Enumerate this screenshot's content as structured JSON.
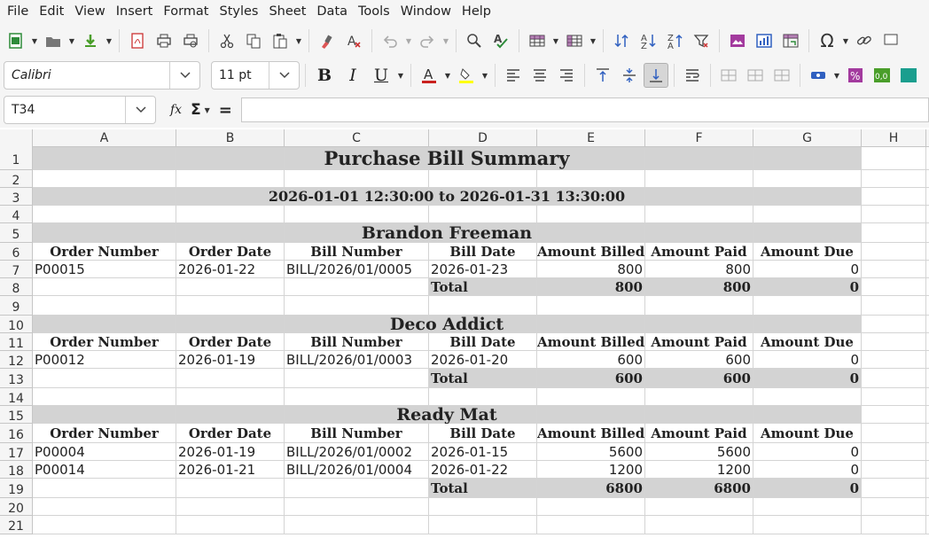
{
  "menu": [
    "File",
    "Edit",
    "View",
    "Insert",
    "Format",
    "Styles",
    "Sheet",
    "Data",
    "Tools",
    "Window",
    "Help"
  ],
  "toolbar2": {
    "font_name": "Calibri",
    "font_size": "11 pt"
  },
  "formula_bar": {
    "cell_ref": "T34",
    "fx": "fx",
    "sigma": "Σ",
    "equals": "="
  },
  "columns": [
    "A",
    "B",
    "C",
    "D",
    "E",
    "F",
    "G",
    "H"
  ],
  "rows": [
    "1",
    "2",
    "3",
    "4",
    "5",
    "6",
    "7",
    "8",
    "9",
    "10",
    "11",
    "12",
    "13",
    "14",
    "15",
    "16",
    "17",
    "18",
    "19",
    "20",
    "21"
  ],
  "sheet": {
    "title": "Purchase Bill Summary",
    "date_range": "2026-01-01 12:30:00 to 2026-01-31 13:30:00",
    "headers": [
      "Order Number",
      "Order Date",
      "Bill Number",
      "Bill Date",
      "Amount Billed",
      "Amount Paid",
      "Amount Due"
    ],
    "vendors": [
      {
        "name": "Brandon Freeman",
        "headers": [
          "Order Number",
          "Order Date",
          "Bill Number",
          "Bill Date",
          "Amount Billed",
          "Amount Paid",
          "Amount Due"
        ],
        "lines": [
          [
            "P00015",
            "2026-01-22",
            "BILL/2026/01/0005",
            "2026-01-23",
            "800",
            "800",
            "0"
          ]
        ],
        "total": {
          "label": "Total",
          "billed": "800",
          "paid": "800",
          "due": "0"
        }
      },
      {
        "name": "Deco Addict",
        "headers": [
          "Order Number",
          "Order Date",
          "Bill Number",
          "Bill Date",
          "Amount Billed",
          "Amount Paid",
          "Amount Due"
        ],
        "lines": [
          [
            "P00012",
            "2026-01-19",
            "BILL/2026/01/0003",
            "2026-01-20",
            "600",
            "600",
            "0"
          ]
        ],
        "total": {
          "label": "Total",
          "billed": "600",
          "paid": "600",
          "due": "0"
        }
      },
      {
        "name": "Ready Mat",
        "headers": [
          "Order Number",
          "Order Date",
          "Bill Number",
          "Bill Date",
          "Amount Billed",
          "Amount Paid",
          "Amount Due"
        ],
        "lines": [
          [
            "P00004",
            "2026-01-19",
            "BILL/2026/01/0002",
            "2026-01-15",
            "5600",
            "5600",
            "0"
          ],
          [
            "P00014",
            "2026-01-21",
            "BILL/2026/01/0004",
            "2026-01-22",
            "1200",
            "1200",
            "0"
          ]
        ],
        "total": {
          "label": "Total",
          "billed": "6800",
          "paid": "6800",
          "due": "0"
        }
      }
    ]
  },
  "colors": {
    "band": "#d3d3d3",
    "grid": "#d4d4d4",
    "chrome": "#f5f5f5"
  }
}
